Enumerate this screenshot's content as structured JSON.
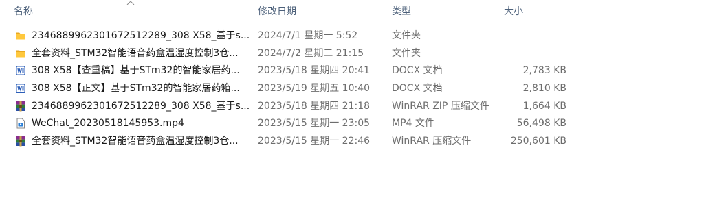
{
  "columns": {
    "name": "名称",
    "date": "修改日期",
    "type": "类型",
    "size": "大小"
  },
  "files": [
    {
      "icon": "folder-icon",
      "name": "2346889962301672512289_308 X58_基于s...",
      "date": "2024/7/1 星期一 5:52",
      "type": "文件夹",
      "size": ""
    },
    {
      "icon": "folder-icon",
      "name": "全套资料_STM32智能语音药盒温湿度控制3仓...",
      "date": "2024/7/2 星期二 21:15",
      "type": "文件夹",
      "size": ""
    },
    {
      "icon": "word-doc-icon",
      "name": "308 X58【查重稿】基于STm32的智能家居药...",
      "date": "2023/5/18 星期四 20:41",
      "type": "DOCX 文档",
      "size": "2,783 KB"
    },
    {
      "icon": "word-doc-icon",
      "name": "308 X58【正文】基于STm32的智能家居药箱...",
      "date": "2023/5/19 星期五 10:40",
      "type": "DOCX 文档",
      "size": "2,810 KB"
    },
    {
      "icon": "winrar-archive-icon",
      "name": "2346889962301672512289_308 X58_基于s...",
      "date": "2023/5/18 星期四 21:18",
      "type": "WinRAR ZIP 压缩文件",
      "size": "1,664 KB"
    },
    {
      "icon": "video-file-icon",
      "name": "WeChat_20230518145953.mp4",
      "date": "2023/5/15 星期一 23:05",
      "type": "MP4 文件",
      "size": "56,498 KB"
    },
    {
      "icon": "winrar-archive-icon",
      "name": "全套资料_STM32智能语音药盒温湿度控制3仓...",
      "date": "2023/5/15 星期一 22:46",
      "type": "WinRAR 压缩文件",
      "size": "250,601 KB"
    }
  ]
}
